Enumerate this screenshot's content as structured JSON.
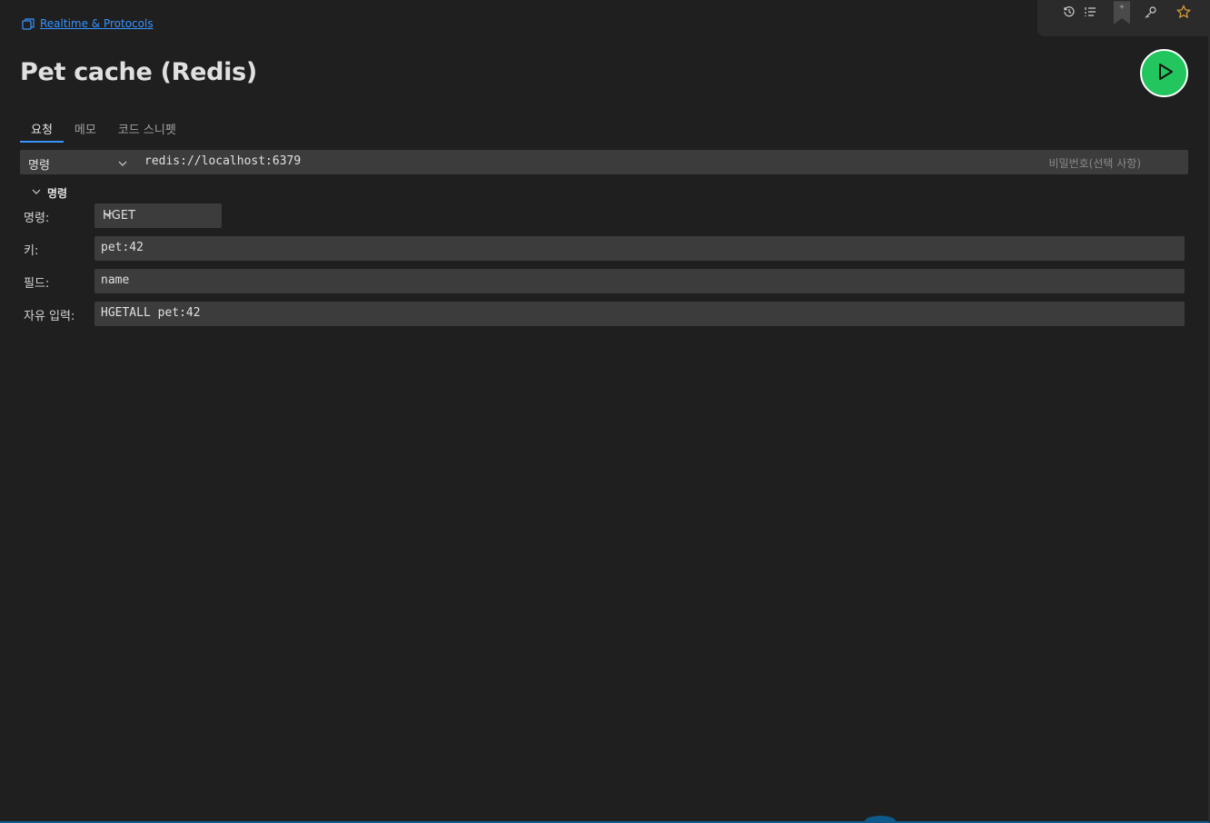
{
  "breadcrumb": {
    "label": "Realtime & Protocols"
  },
  "toolbar": {
    "icons": [
      "history-icon",
      "list-icon",
      "bookmark-icon",
      "key-icon",
      "star-icon"
    ],
    "star_color": "#e0a33a"
  },
  "page": {
    "title": "Pet cache (Redis)"
  },
  "tabs": [
    {
      "label": "요청"
    },
    {
      "label": "메모"
    },
    {
      "label": "코드 스니펫"
    }
  ],
  "request": {
    "type_label": "명령",
    "url": "redis://localhost:6379",
    "password_placeholder": "비밀번호(선택 사항)"
  },
  "section": {
    "label": "명령"
  },
  "form": {
    "command_label": "명령:",
    "command_value": "HGET",
    "key_label": "키:",
    "key_value": "pet:42",
    "field_label": "필드:",
    "field_value": "name",
    "raw_label": "자유 입력:",
    "raw_value": "HGETALL pet:42"
  },
  "colors": {
    "accent": "#3794ff",
    "run": "#23c55e",
    "background": "#1f1f1f",
    "input": "#3c3c3c"
  }
}
